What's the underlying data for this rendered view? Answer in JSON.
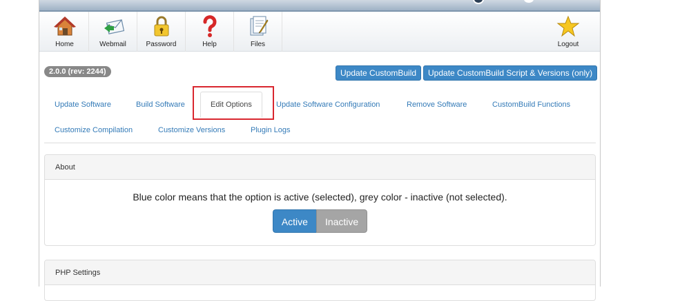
{
  "toolbar": {
    "items": [
      {
        "label": "Home",
        "icon": "home-icon"
      },
      {
        "label": "Webmail",
        "icon": "mail-icon"
      },
      {
        "label": "Password",
        "icon": "lock-icon"
      },
      {
        "label": "Help",
        "icon": "question-icon"
      },
      {
        "label": "Files",
        "icon": "files-icon"
      }
    ],
    "logout": {
      "label": "Logout",
      "icon": "star-icon"
    }
  },
  "version": "2.0.0 (rev: 2244)",
  "actions": {
    "update_cb": "Update CustomBuild",
    "update_cb_script": "Update CustomBuild Script & Versions (only)"
  },
  "tabs": [
    {
      "label": "Update Software"
    },
    {
      "label": "Build Software"
    },
    {
      "label": "Edit Options",
      "active": true
    },
    {
      "label": "Update Software Configuration"
    },
    {
      "label": "Remove Software"
    },
    {
      "label": "CustomBuild Functions"
    },
    {
      "label": "Customize Compilation"
    },
    {
      "label": "Customize Versions"
    },
    {
      "label": "Plugin Logs"
    }
  ],
  "about": {
    "title": "About",
    "text": "Blue color means that the option is active (selected), grey color - inactive (not selected).",
    "active_label": "Active",
    "inactive_label": "Inactive"
  },
  "php_panel": {
    "title": "PHP Settings"
  },
  "colors": {
    "accent": "#3d88c6",
    "inactive": "#a5a5a5",
    "highlight": "#d9262e",
    "link": "#337ab7"
  }
}
